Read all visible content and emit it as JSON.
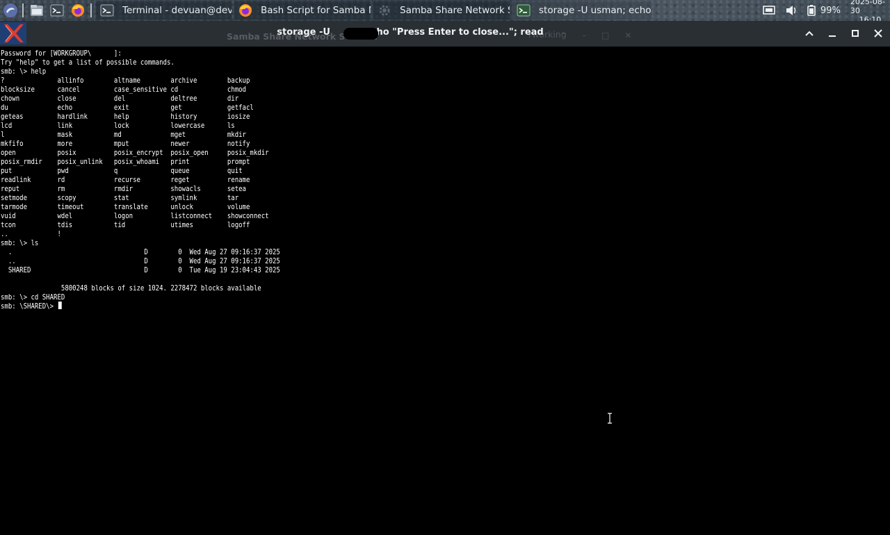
{
  "taskbar": {
    "launchers": [
      {
        "icon": "menu-swirl-icon"
      },
      {
        "icon": "file-manager-icon"
      },
      {
        "icon": "terminal-icon"
      },
      {
        "icon": "firefox-icon"
      }
    ],
    "tasks": [
      {
        "label": "Terminal - devuan@devu...",
        "icon": "terminal-icon"
      },
      {
        "label": "Bash Script for Samba N...",
        "icon": "firefox-icon"
      },
      {
        "label": "Samba Share Network Sc...",
        "icon": "gear-icon"
      },
      {
        "label": "storage -U usman; echo ...",
        "icon": "terminal-icon",
        "active": true
      }
    ],
    "tray": {
      "battery": "99%",
      "date": "2025-08-30",
      "time": "16:10"
    }
  },
  "window": {
    "title_before": "storage -U",
    "title_after": "echo \"Press Enter to close...\"; read",
    "background_window_title": "Samba Share Network Scanner",
    "background_window_fragment": "rworking"
  },
  "terminal": {
    "lines": [
      "Password for [WORKGROUP\\      ]:",
      "Try \"help\" to get a list of possible commands.",
      "smb: \\> help",
      "?              allinfo        altname        archive        backup",
      "blocksize      cancel         case_sensitive cd             chmod",
      "chown          close          del            deltree        dir",
      "du             echo           exit           get            getfacl",
      "geteas         hardlink       help           history        iosize",
      "lcd            link           lock           lowercase      ls",
      "l              mask           md             mget           mkdir",
      "mkfifo         more           mput           newer          notify",
      "open           posix          posix_encrypt  posix_open     posix_mkdir",
      "posix_rmdir    posix_unlink   posix_whoami   print          prompt",
      "put            pwd            q              queue          quit",
      "readlink       rd             recurse        reget          rename",
      "reput          rm             rmdir          showacls       setea",
      "setmode        scopy          stat           symlink        tar",
      "tarmode        timeout        translate      unlock         volume",
      "vuid           wdel           logon          listconnect    showconnect",
      "tcon           tdis           tid            utimes         logoff",
      "..             !",
      "smb: \\> ls",
      "  .                                   D        0  Wed Aug 27 09:16:37 2025",
      "  ..                                  D        0  Wed Aug 27 09:16:37 2025",
      "  SHARED                              D        0  Tue Aug 19 23:04:43 2025",
      "",
      "                5800248 blocks of size 1024. 2278472 blocks available",
      "smb: \\> cd SHARED"
    ],
    "prompt": "smb: \\SHARED\\> "
  }
}
